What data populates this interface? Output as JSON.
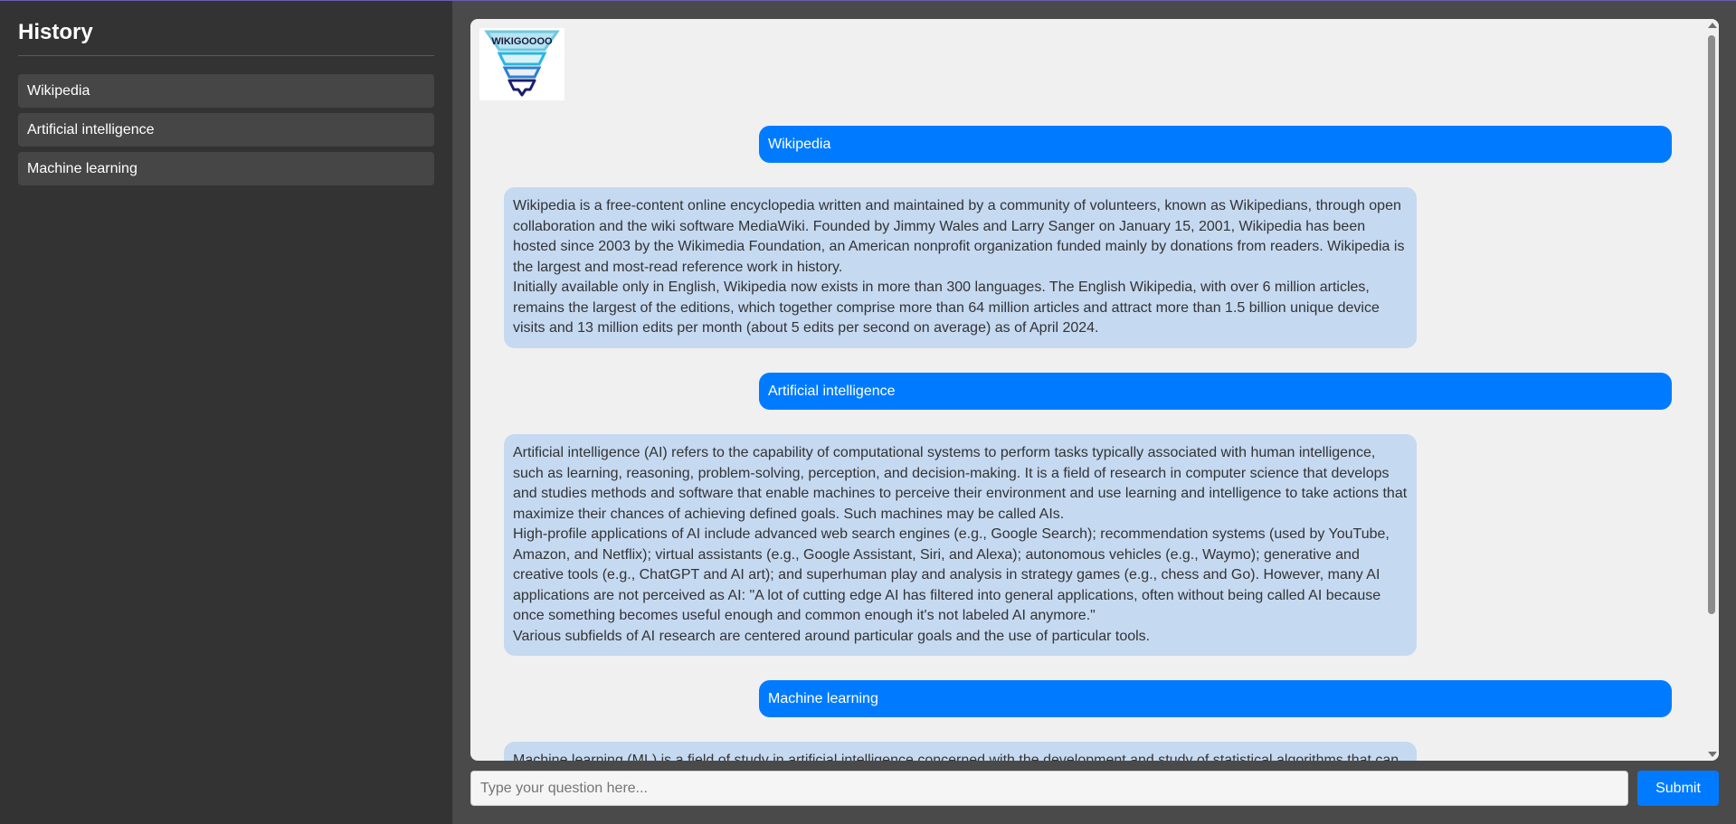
{
  "sidebar": {
    "title": "History",
    "items": [
      {
        "label": "Wikipedia"
      },
      {
        "label": "Artificial intelligence"
      },
      {
        "label": "Machine learning"
      }
    ]
  },
  "logo": {
    "text": "WIKIGOOOO"
  },
  "chat": {
    "messages": [
      {
        "role": "user",
        "text": "Wikipedia"
      },
      {
        "role": "bot",
        "paragraphs": [
          "Wikipedia is a free-content online encyclopedia written and maintained by a community of volunteers, known as Wikipedians, through open collaboration and the wiki software MediaWiki. Founded by Jimmy Wales and Larry Sanger on January 15, 2001, Wikipedia has been hosted since 2003 by the Wikimedia Foundation, an American nonprofit organization funded mainly by donations from readers. Wikipedia is the largest and most-read reference work in history.",
          "Initially available only in English, Wikipedia now exists in more than 300 languages. The English Wikipedia, with over 6 million articles, remains the largest of the editions, which together comprise more than 64 million articles and attract more than 1.5 billion unique device visits and 13 million edits per month (about 5 edits per second on average) as of April 2024."
        ]
      },
      {
        "role": "user",
        "text": "Artificial intelligence"
      },
      {
        "role": "bot",
        "paragraphs": [
          "Artificial intelligence (AI) refers to the capability of computational systems to perform tasks typically associated with human intelligence, such as learning, reasoning, problem-solving, perception, and decision-making. It is a field of research in computer science that develops and studies methods and software that enable machines to perceive their environment and use learning and intelligence to take actions that maximize their chances of achieving defined goals. Such machines may be called AIs.",
          "High-profile applications of AI include advanced web search engines (e.g., Google Search); recommendation systems (used by YouTube, Amazon, and Netflix); virtual assistants (e.g., Google Assistant, Siri, and Alexa); autonomous vehicles (e.g., Waymo); generative and creative tools (e.g., ChatGPT and AI art); and superhuman play and analysis in strategy games (e.g., chess and Go). However, many AI applications are not perceived as AI: \"A lot of cutting edge AI has filtered into general applications, often without being called AI because once something becomes useful enough and common enough it's not labeled AI anymore.\"",
          "Various subfields of AI research are centered around particular goals and the use of particular tools."
        ]
      },
      {
        "role": "user",
        "text": "Machine learning"
      },
      {
        "role": "bot",
        "paragraphs": [
          "Machine learning (ML) is a field of study in artificial intelligence concerned with the development and study of statistical algorithms that can"
        ]
      }
    ]
  },
  "input": {
    "placeholder": "Type your question here...",
    "value": ""
  },
  "submit_label": "Submit",
  "colors": {
    "accent": "#007bff",
    "bot_bubble": "#c5d9f1",
    "sidebar_bg": "#333333",
    "chat_bg": "#f0f0f0"
  }
}
